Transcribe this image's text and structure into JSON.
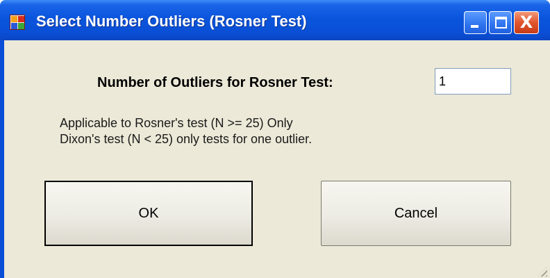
{
  "window": {
    "title": "Select Number Outliers (Rosner Test)",
    "icon": "app-icon",
    "controls": {
      "minimize_icon": "minimize-icon",
      "maximize_icon": "maximize-icon",
      "close_icon": "close-icon",
      "close_glyph": "X"
    }
  },
  "form": {
    "outliers_label": "Number of Outliers for Rosner Test:",
    "outliers_value": "1",
    "note_line1": "Applicable to Rosner's test (N >= 25) Only",
    "note_line2": "Dixon's test (N < 25) only tests for one outlier."
  },
  "buttons": {
    "ok_label": "OK",
    "cancel_label": "Cancel"
  },
  "colors": {
    "titlebar": "#0a55dc",
    "client_bg": "#ece9d8",
    "close_button": "#e2552e"
  }
}
